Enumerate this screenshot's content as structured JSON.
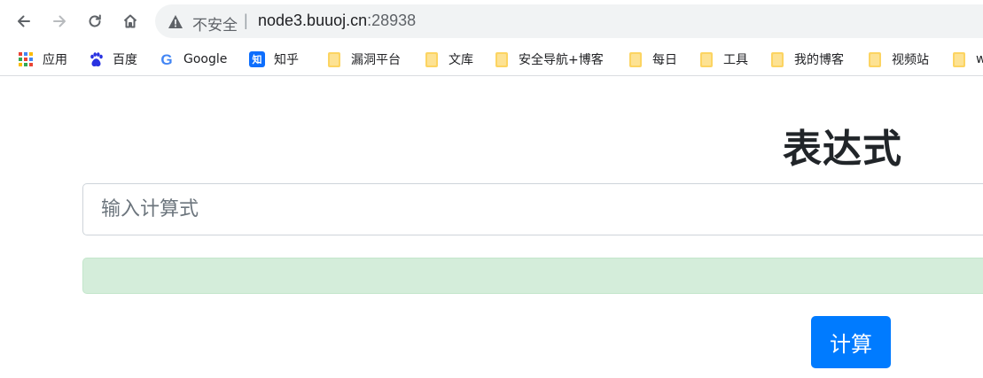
{
  "browser": {
    "security_label": "不安全",
    "separator": "|",
    "url_host": "node3.buuoj.cn",
    "url_port": ":28938"
  },
  "bookmarks": [
    {
      "label": "应用",
      "icon": "apps-grid-icon"
    },
    {
      "label": "百度",
      "icon": "baidu-paw-icon"
    },
    {
      "label": "Google",
      "icon": "google-icon"
    },
    {
      "label": "知乎",
      "icon": "zhihu-icon"
    },
    {
      "label": "漏洞平台",
      "icon": "folder-icon"
    },
    {
      "label": "文库",
      "icon": "folder-icon"
    },
    {
      "label": "安全导航+博客",
      "icon": "folder-icon"
    },
    {
      "label": "每日",
      "icon": "folder-icon"
    },
    {
      "label": "工具",
      "icon": "folder-icon"
    },
    {
      "label": "我的博客",
      "icon": "folder-icon"
    },
    {
      "label": "视频站",
      "icon": "folder-icon"
    },
    {
      "label": "w",
      "icon": "folder-icon"
    }
  ],
  "page": {
    "title": "表达式",
    "input_placeholder": "输入计算式",
    "input_value": "",
    "result_text": "",
    "submit_label": "计算"
  },
  "colors": {
    "primary": "#007bff",
    "success_bg": "#d4edda",
    "folder": "#fcd462"
  }
}
